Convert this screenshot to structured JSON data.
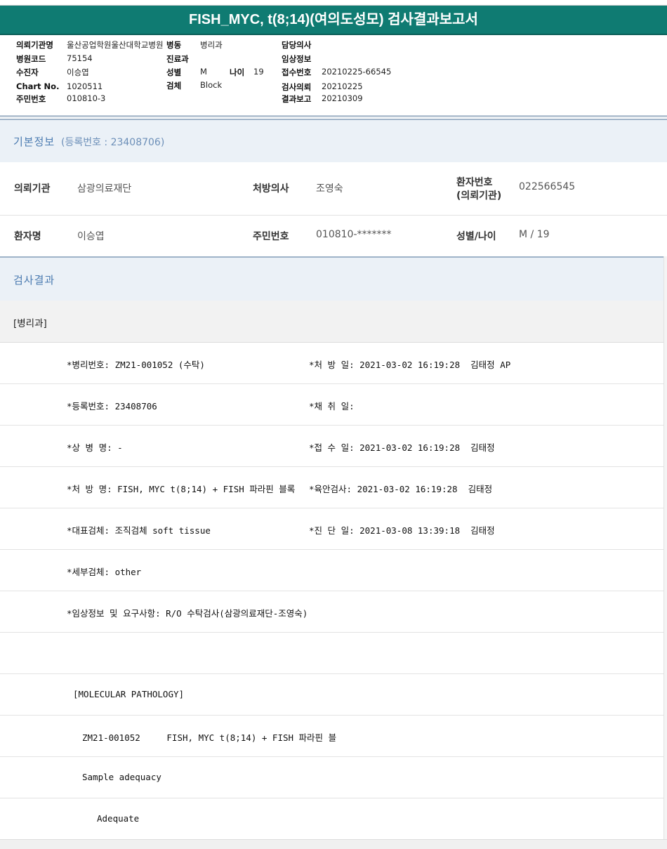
{
  "title": "FISH_MYC, t(8;14)(여의도성모) 검사결과보고서",
  "report_info": {
    "institution_label": "의뢰기관명",
    "institution": "울산공업학원울산대학교병원",
    "ward_label": "병동",
    "ward": "병리과",
    "doctor_label": "담당의사",
    "doctor": "",
    "hospital_code_label": "병원코드",
    "hospital_code": "75154",
    "dept_label": "진료과",
    "dept": "",
    "clinical_label": "임상정보",
    "clinical": "",
    "patient_label": "수진자",
    "patient": "이승엽",
    "sex_label": "성별",
    "sex": "M",
    "age_label": "나이",
    "age": "19",
    "receipt_no_label": "접수번호",
    "receipt_no": "20210225-66545",
    "chart_label": "Chart No.",
    "chart": "1020511",
    "specimen_label": "검체",
    "specimen": "Block",
    "request_label": "검사의뢰",
    "request_date": "20210225",
    "rrn_label": "주민번호",
    "rrn": "010810-3",
    "report_label": "결과보고",
    "report_date": "20210309"
  },
  "basic_info": {
    "header": "기본정보",
    "reg_text": "(등록번호 : 23408706)",
    "institution_label": "의뢰기관",
    "institution": "삼광의료재단",
    "doctor_label": "처방의사",
    "doctor": "조영숙",
    "patient_no_label1": "환자번호",
    "patient_no_label2": "(의뢰기관)",
    "patient_no": "022566545",
    "name_label": "환자명",
    "name": "이승엽",
    "rrn_label": "주민번호",
    "rrn": "010810-*******",
    "sexage_label": "성별/나이",
    "sexage": "M / 19"
  },
  "results": {
    "header": "검사결과",
    "dept": "[병리과]",
    "lines": [
      {
        "left": "*병리번호: ZM21-001052 (수탁)",
        "right": "*처 방 일: 2021-03-02 16:19:28  김태정 AP"
      },
      {
        "left": "*등록번호: 23408706",
        "right": "*채 취 일:"
      },
      {
        "left": "*상 병 명: -",
        "right": "*접 수 일: 2021-03-02 16:19:28  김태정"
      },
      {
        "left": "*처 방 명: FISH, MYC t(8;14) + FISH 파라핀 블록",
        "right": "*육안검사: 2021-03-02 16:19:28  김태정"
      },
      {
        "left": "*대표검체: 조직검체 soft tissue",
        "right": "*진 단 일: 2021-03-08 13:39:18  김태정"
      },
      {
        "left": "*세부검체: other",
        "right": ""
      },
      {
        "left": "*임상정보 및 요구사항: R/O 수탁검사(삼광의료재단-조영숙)",
        "right": ""
      },
      {
        "left": "",
        "right": ""
      },
      {
        "left": "[MOLECULAR PATHOLOGY]",
        "right": ""
      },
      {
        "left": "ZM21-001052     FISH, MYC t(8;14) + FISH 파라핀 블",
        "right": ""
      },
      {
        "left": "Sample adequacy",
        "right": ""
      },
      {
        "left": "Adequate",
        "right": ""
      }
    ]
  }
}
